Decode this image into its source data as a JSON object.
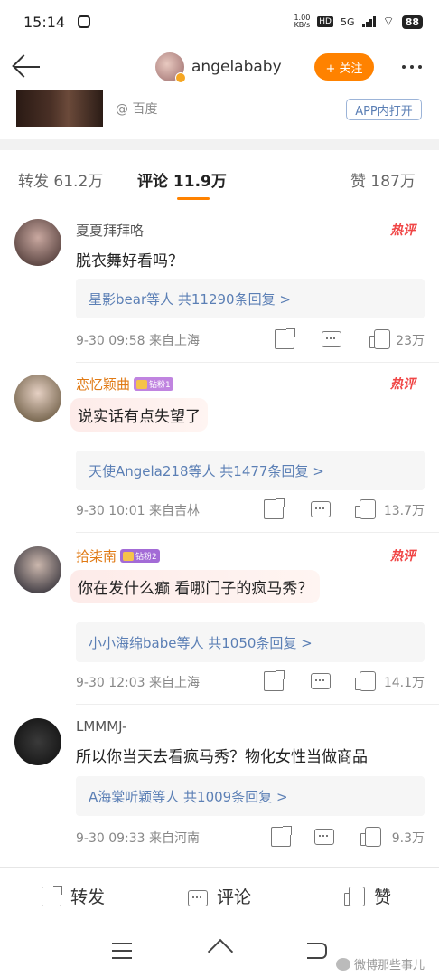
{
  "status": {
    "time": "15:14",
    "speed_value": "1.00",
    "speed_unit": "KB/s",
    "hd": "HD",
    "network": "5G",
    "battery": "88"
  },
  "nav": {
    "username": "angelababy",
    "follow_label": "+ 关注"
  },
  "source": {
    "label": "@ 百度",
    "app_open": "APP内打开"
  },
  "tabs": [
    {
      "label": "转发 61.2万"
    },
    {
      "label": "评论 11.9万"
    },
    {
      "label": "赞 187万"
    }
  ],
  "comments": [
    {
      "name": "夏夏拜拜咯",
      "badge": "",
      "hot": "热评",
      "text": "脱衣舞好看吗？",
      "reply": "星影bear等人 共11290条回复 >",
      "date": "9-30 09:58 来自上海",
      "likes": "23万"
    },
    {
      "name": "恋忆颖曲",
      "badge": "钻粉1",
      "hot": "热评",
      "text": "说实话有点失望了",
      "reply": "天使Angela218等人 共1477条回复 >",
      "date": "9-30 10:01 来自吉林",
      "likes": "13.7万"
    },
    {
      "name": "拾柒南",
      "badge": "钻粉2",
      "hot": "热评",
      "text": "你在发什么癫 看哪门子的疯马秀？",
      "reply": "小小海绵babe等人 共1050条回复 >",
      "date": "9-30 12:03 来自上海",
      "likes": "14.1万"
    },
    {
      "name": "LMMMJ-",
      "badge": "",
      "hot": "",
      "text": "所以你当天去看疯马秀？物化女性当做商品",
      "reply": "A海棠听颖等人 共1009条回复 >",
      "date": "9-30 09:33 来自河南",
      "likes": "9.3万"
    }
  ],
  "bottom_bar": {
    "repost": "转发",
    "comment": "评论",
    "like": "赞"
  },
  "watermark": "微博那些事儿",
  "colors": {
    "accent": "#ff8200",
    "link": "#5b7fb5",
    "hot": "#f04646"
  }
}
